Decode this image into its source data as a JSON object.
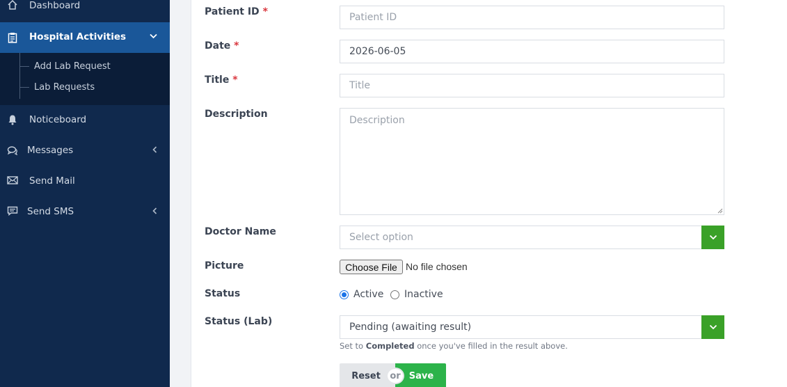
{
  "sidebar": {
    "items": [
      {
        "label": "Dashboard",
        "icon": "home-icon"
      },
      {
        "label": "Hospital Activities",
        "icon": "clipboard-icon",
        "active": true
      },
      {
        "label": "Noticeboard",
        "icon": "bell-icon"
      },
      {
        "label": "Messages",
        "icon": "chat-icon"
      },
      {
        "label": "Send Mail",
        "icon": "envelope-icon"
      },
      {
        "label": "Send SMS",
        "icon": "sms-icon"
      }
    ],
    "submenu": [
      {
        "label": "Add Lab Request"
      },
      {
        "label": "Lab Requests"
      }
    ]
  },
  "form": {
    "patient_id": {
      "label": "Patient ID",
      "required": "*",
      "placeholder": "Patient ID",
      "value": ""
    },
    "date": {
      "label": "Date",
      "required": "*",
      "value": "2026-06-05"
    },
    "title": {
      "label": "Title",
      "required": "*",
      "placeholder": "Title",
      "value": ""
    },
    "description": {
      "label": "Description",
      "placeholder": "Description"
    },
    "doctor": {
      "label": "Doctor Name",
      "value": "Select option"
    },
    "picture": {
      "label": "Picture",
      "button": "Choose File",
      "status": "No file chosen"
    },
    "status": {
      "label": "Status",
      "options": [
        "Active",
        "Inactive"
      ],
      "selected": "Active"
    },
    "status_lab": {
      "label": "Status (Lab)",
      "value": "Pending (awaiting result)",
      "help_prefix": "Set to ",
      "help_bold": "Completed",
      "help_suffix": " once you've filled in the result above."
    },
    "buttons": {
      "reset": "Reset",
      "or": "or",
      "save": "Save"
    }
  },
  "colors": {
    "sidebar": "#10294d",
    "active": "#1a5799",
    "accent_green": "#3aa128",
    "save": "#2cb34a",
    "required": "#d9363e"
  }
}
